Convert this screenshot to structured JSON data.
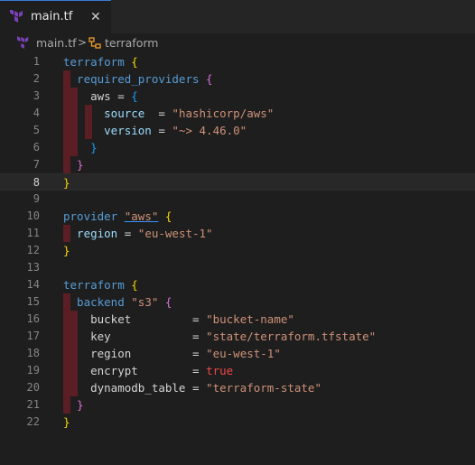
{
  "tab": {
    "filename": "main.tf",
    "close_glyph": "✕"
  },
  "breadcrumb": {
    "file": "main.tf",
    "separator": ">",
    "symbol": "terraform"
  },
  "editor": {
    "active_line": 8,
    "line_numbers": [
      "1",
      "2",
      "3",
      "4",
      "5",
      "6",
      "7",
      "8",
      "9",
      "10",
      "11",
      "12",
      "13",
      "14",
      "15",
      "16",
      "17",
      "18",
      "19",
      "20",
      "21",
      "22"
    ],
    "lines": [
      [
        {
          "t": "terraform",
          "c": "kw"
        },
        {
          "t": " ",
          "c": "sym"
        },
        {
          "t": "{",
          "c": "brace1"
        }
      ],
      [
        {
          "t": "  required_providers",
          "c": "kw"
        },
        {
          "t": " ",
          "c": "sym"
        },
        {
          "t": "{",
          "c": "brace2"
        }
      ],
      [
        {
          "t": "    aws",
          "c": "sym"
        },
        {
          "t": " = ",
          "c": "op"
        },
        {
          "t": "{",
          "c": "brace3"
        }
      ],
      [
        {
          "t": "      source",
          "c": "id"
        },
        {
          "t": "  = ",
          "c": "op"
        },
        {
          "t": "\"hashicorp/aws\"",
          "c": "str"
        }
      ],
      [
        {
          "t": "      version",
          "c": "id"
        },
        {
          "t": " = ",
          "c": "op"
        },
        {
          "t": "\"~> 4.46.0\"",
          "c": "str"
        }
      ],
      [
        {
          "t": "    }",
          "c": "brace3"
        }
      ],
      [
        {
          "t": "  }",
          "c": "brace2"
        }
      ],
      [
        {
          "t": "}",
          "c": "brace1"
        }
      ],
      [],
      [
        {
          "t": "provider",
          "c": "kw"
        },
        {
          "t": " ",
          "c": "sym"
        },
        {
          "t": "\"aws\"",
          "c": "str ul"
        },
        {
          "t": " ",
          "c": "sym"
        },
        {
          "t": "{",
          "c": "brace1"
        }
      ],
      [
        {
          "t": "  region",
          "c": "id"
        },
        {
          "t": " = ",
          "c": "op"
        },
        {
          "t": "\"eu-west-1\"",
          "c": "str"
        }
      ],
      [
        {
          "t": "}",
          "c": "brace1"
        }
      ],
      [],
      [
        {
          "t": "terraform",
          "c": "kw"
        },
        {
          "t": " ",
          "c": "sym"
        },
        {
          "t": "{",
          "c": "brace1"
        }
      ],
      [
        {
          "t": "  backend",
          "c": "kw"
        },
        {
          "t": " ",
          "c": "sym"
        },
        {
          "t": "\"s3\"",
          "c": "str"
        },
        {
          "t": " ",
          "c": "sym"
        },
        {
          "t": "{",
          "c": "brace2"
        }
      ],
      [
        {
          "t": "    bucket",
          "c": "sym"
        },
        {
          "t": "         = ",
          "c": "op"
        },
        {
          "t": "\"bucket-name\"",
          "c": "str"
        }
      ],
      [
        {
          "t": "    key",
          "c": "sym"
        },
        {
          "t": "            = ",
          "c": "op"
        },
        {
          "t": "\"state/terraform.tfstate\"",
          "c": "str"
        }
      ],
      [
        {
          "t": "    region",
          "c": "sym"
        },
        {
          "t": "         = ",
          "c": "op"
        },
        {
          "t": "\"eu-west-1\"",
          "c": "str"
        }
      ],
      [
        {
          "t": "    encrypt",
          "c": "sym"
        },
        {
          "t": "        = ",
          "c": "op"
        },
        {
          "t": "true",
          "c": "bool"
        }
      ],
      [
        {
          "t": "    dynamodb_table",
          "c": "sym"
        },
        {
          "t": " = ",
          "c": "op"
        },
        {
          "t": "\"terraform-state\"",
          "c": "str"
        }
      ],
      [
        {
          "t": "  }",
          "c": "brace2"
        }
      ],
      [
        {
          "t": "}",
          "c": "brace1"
        }
      ]
    ]
  },
  "colors": {
    "background": "#1e1e1e",
    "tab_bar": "#252526",
    "keyword": "#569cd6",
    "string": "#ce9178",
    "indent_guide": "#5a1e24"
  },
  "icons": {
    "file_icon": "terraform-icon",
    "symbol_icon": "symbol-structure-icon"
  }
}
